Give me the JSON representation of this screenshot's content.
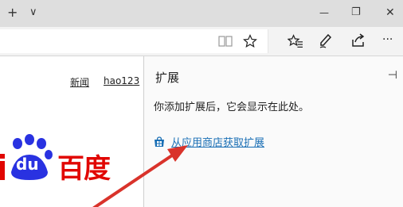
{
  "titlebar": {
    "new_tab_symbol": "+",
    "tab_list_symbol": "∨",
    "minimize_symbol": "—",
    "restore_symbol": "❐",
    "close_symbol": "✕"
  },
  "address_bar": {
    "reading_view_icon": "book-icon",
    "favorite_icon": "star-icon",
    "favorites_hub_icon": "favorites-icon",
    "notes_icon": "pen-icon",
    "share_icon": "share-icon",
    "more_symbol": "···"
  },
  "page": {
    "top_links": [
      "新闻",
      "hao123"
    ],
    "logo": {
      "chinese_text": "百度",
      "latin_text": "du",
      "colors": {
        "blue": "#2932e1",
        "red": "#e10602"
      }
    }
  },
  "extensions_panel": {
    "title": "扩展",
    "pin_symbol": "⊣",
    "message": "你添加扩展后，它会显示在此处。",
    "store_link_label": "从应用商店获取扩展",
    "store_icon": "store-icon"
  },
  "annotation": {
    "arrow_color": "#d9332b"
  }
}
